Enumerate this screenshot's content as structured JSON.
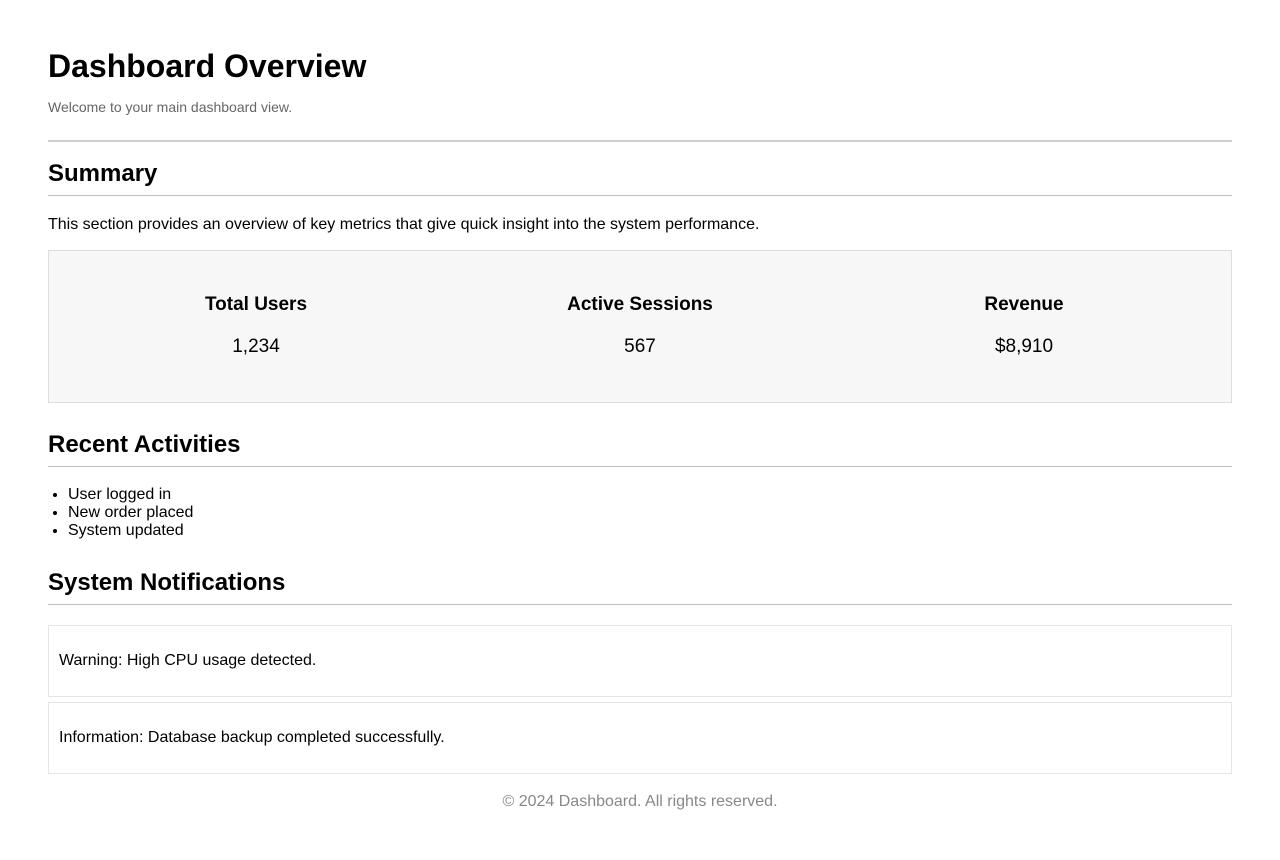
{
  "header": {
    "title": "Dashboard Overview",
    "subtitle": "Welcome to your main dashboard view."
  },
  "summary": {
    "heading": "Summary",
    "description": "This section provides an overview of key metrics that give quick insight into the system performance.",
    "metrics": [
      {
        "label": "Total Users",
        "value": "1,234"
      },
      {
        "label": "Active Sessions",
        "value": "567"
      },
      {
        "label": "Revenue",
        "value": "$8,910"
      }
    ]
  },
  "activities": {
    "heading": "Recent Activities",
    "items": [
      "User logged in",
      "New order placed",
      "System updated"
    ]
  },
  "notifications": {
    "heading": "System Notifications",
    "items": [
      "Warning: High CPU usage detected.",
      "Information: Database backup completed successfully."
    ]
  },
  "footer": {
    "text": "© 2024 Dashboard. All rights reserved."
  },
  "colors": {
    "text": "#000000",
    "muted": "#666666",
    "footer": "#888888",
    "panel_bg": "#f7f7f7",
    "border": "#dddddd"
  }
}
